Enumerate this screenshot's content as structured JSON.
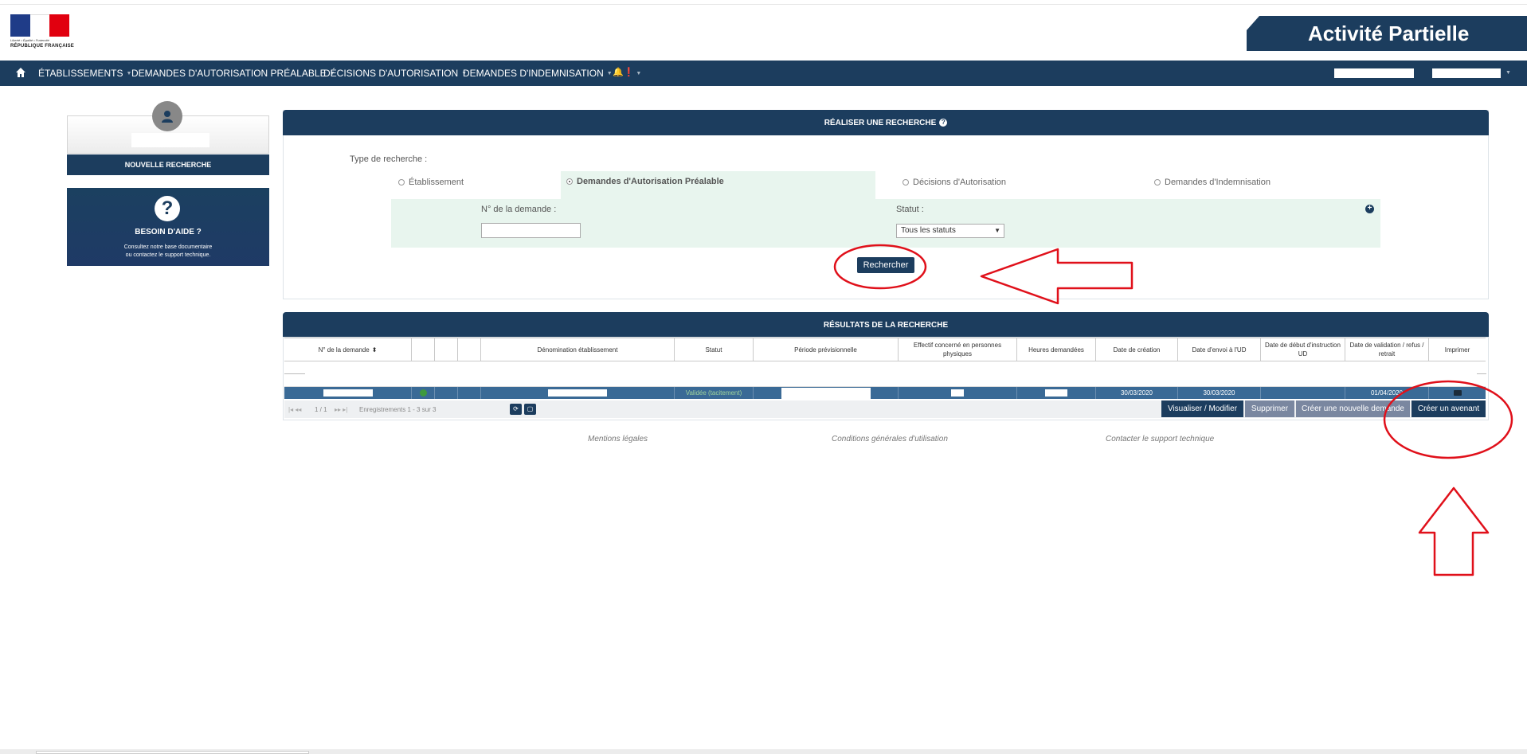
{
  "header": {
    "logo_motto": "Liberté • Égalité • Fraternité",
    "logo_country": "RÉPUBLIQUE FRANÇAISE",
    "app_title": "Activité Partielle"
  },
  "nav": {
    "items": [
      {
        "label": "ÉTABLISSEMENTS"
      },
      {
        "label": "DEMANDES D'AUTORISATION PRÉALABLE"
      },
      {
        "label": "DÉCISIONS D'AUTORISATION"
      },
      {
        "label": "DEMANDES D'INDEMNISATION"
      }
    ],
    "alert_icons": "🔔❗"
  },
  "sidebar": {
    "new_search_label": "NOUVELLE RECHERCHE",
    "help_title": "BESOIN D'AIDE ?",
    "help_text_1": "Consultez notre base documentaire",
    "help_text_2": "ou contactez le support technique."
  },
  "search": {
    "title": "RÉALISER UNE RECHERCHE",
    "type_label": "Type de recherche :",
    "options": [
      {
        "label": "Établissement"
      },
      {
        "label": "Demandes d'Autorisation Préalable"
      },
      {
        "label": "Décisions d'Autorisation"
      },
      {
        "label": "Demandes d'Indemnisation"
      }
    ],
    "selected_option": "Demandes d'Autorisation Préalable",
    "num_label": "N° de la demande :",
    "num_value": "",
    "status_label": "Statut :",
    "status_value": "Tous les statuts",
    "search_button": "Rechercher"
  },
  "results": {
    "title": "RÉSULTATS DE LA RECHERCHE",
    "columns": [
      "N° de la demande",
      "",
      "",
      "",
      "Dénomination établissement",
      "Statut",
      "Période prévisionnelle",
      "Effectif concerné en personnes physiques",
      "Heures demandées",
      "Date de création",
      "Date d'envoi à l'UD",
      "Date de début d'instruction UD",
      "Date de validation / refus / retrait",
      "Imprimer"
    ],
    "row": {
      "status": "Validée (tacitement)",
      "date_creation": "30/03/2020",
      "date_envoi": "30/03/2020",
      "date_validation": "01/04/2020"
    },
    "pager": {
      "page": "1 / 1",
      "records": "Enregistrements 1 - 3 sur 3"
    },
    "actions": {
      "view_edit": "Visualiser / Modifier",
      "delete": "Supprimer",
      "new_request": "Créer une nouvelle demande",
      "amendment": "Créer un avenant"
    }
  },
  "footer": {
    "legal": "Mentions légales",
    "terms": "Conditions générales d'utilisation",
    "contact": "Contacter le support technique"
  },
  "colors": {
    "primary": "#1c3d5e",
    "row_selected": "#3a6a96",
    "criteria_bg": "#e8f5ee",
    "annotation": "#e0101a"
  }
}
